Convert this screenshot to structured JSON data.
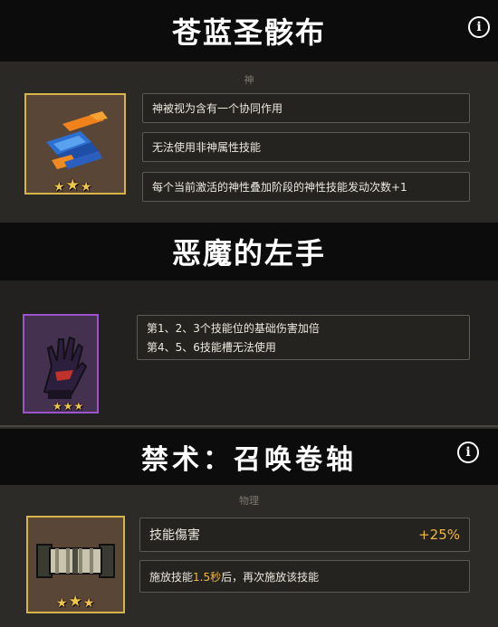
{
  "items": [
    {
      "title": "苍蓝圣骸布",
      "category": "神",
      "stars": 3,
      "frame_color": "#d7b44a",
      "icon": "blue-cloth-icon",
      "effects": [
        "神被视为含有一个协同作用",
        "无法使用非神属性技能",
        "每个当前激活的神性叠加阶段的神性技能发动次数+1"
      ]
    },
    {
      "title": "恶魔的左手",
      "stars": 3,
      "frame_color": "#9b54c9",
      "icon": "demon-hand-icon",
      "effect_lines": [
        "第1、2、3个技能位的基础伤害加倍",
        "第4、5、6技能槽无法使用"
      ]
    },
    {
      "title": "禁术：召唤卷轴",
      "category": "物理",
      "stars": 3,
      "frame_color": "#d7b44a",
      "icon": "scroll-icon",
      "stat_label": "技能傷害",
      "stat_value": "+25%",
      "effect_pre": "施放技能",
      "effect_highlight": "1.5秒",
      "effect_post": "后，再次施放该技能"
    }
  ],
  "colors": {
    "highlight": "#f3b63c",
    "gold": "#d7b44a",
    "purple": "#9b54c9"
  }
}
